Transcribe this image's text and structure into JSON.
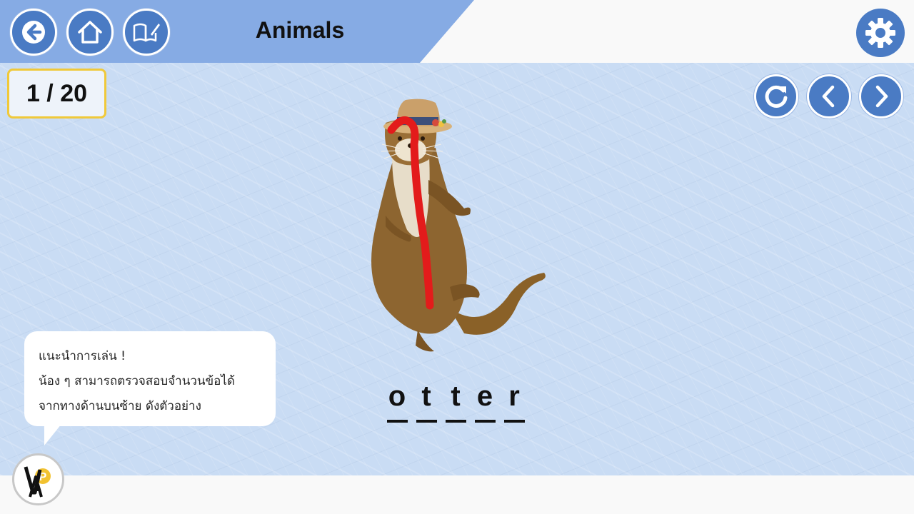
{
  "header": {
    "title": "Animals",
    "back_icon": "arrow-left-icon",
    "home_icon": "home-icon",
    "book_icon": "open-book-pencil-icon",
    "settings_icon": "gear-icon",
    "accent_color": "#86abe4",
    "button_color": "#4a7bc4"
  },
  "progress": {
    "label": "1 / 20",
    "current": 1,
    "total": 20
  },
  "controls": {
    "reload_icon": "refresh-icon",
    "prev_icon": "chevron-left-icon",
    "next_icon": "chevron-right-icon"
  },
  "card": {
    "image": "otter-with-straw-hat",
    "trace_color": "#e31b1b",
    "letters": [
      "o",
      "t",
      "t",
      "e",
      "r"
    ]
  },
  "tip": {
    "line1": "แนะนำการเล่น !",
    "line2": "น้อง ๆ สามารถตรวจสอบจำนวนข้อได้",
    "line3": "จากทางด้านบนซ้าย ดังตัวอย่าง"
  },
  "brand": {
    "logo": "vpa-logo",
    "logo_text": "VPA"
  }
}
